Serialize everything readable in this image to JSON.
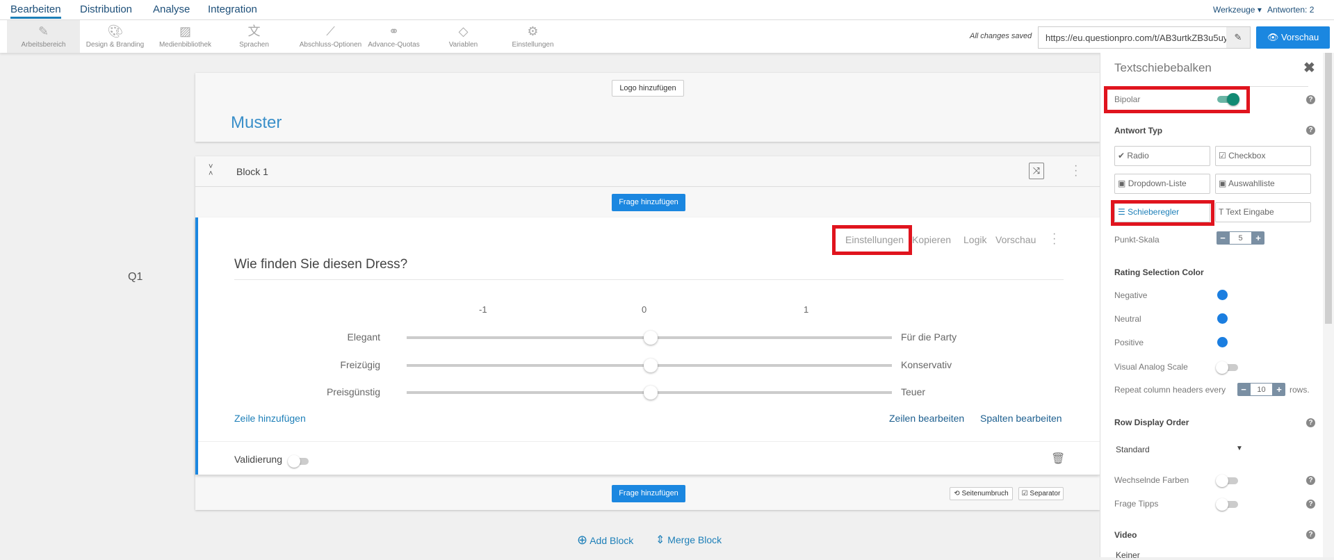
{
  "nav": {
    "tabs": [
      "Bearbeiten",
      "Distribution",
      "Analyse",
      "Integration"
    ],
    "tools": "Werkzeuge",
    "answers": "Antworten: 2"
  },
  "toolbar": {
    "items": [
      "Arbeitsbereich",
      "Design & Branding",
      "Medienbibliothek",
      "Sprachen",
      "Abschluss-Optionen",
      "Advance-Quotas",
      "Variablen",
      "Einstellungen"
    ],
    "saved": "All changes saved",
    "url": "https://eu.questionpro.com/t/AB3urtkZB3u5uy",
    "preview": "Vorschau"
  },
  "survey": {
    "logo_button": "Logo hinzufügen",
    "title": "Muster",
    "block": "Block 1",
    "add_question": "Frage hinzufügen",
    "qnum": "Q1",
    "question": {
      "actions": [
        "Einstellungen",
        "Kopieren",
        "Logik",
        "Vorschau"
      ],
      "text": "Wie finden Sie diesen Dress?",
      "scale": [
        "-1",
        "0",
        "1"
      ],
      "rows": [
        {
          "left": "Elegant",
          "right": "Für die Party",
          "value": 0
        },
        {
          "left": "Freizügig",
          "right": "Konservativ",
          "value": 0
        },
        {
          "left": "Preisgünstig",
          "right": "Teuer",
          "value": 0
        }
      ],
      "add_row": "Zeile hinzufügen",
      "edit_rows": "Zeilen bearbeiten",
      "edit_cols": "Spalten bearbeiten",
      "validation": "Validierung"
    },
    "page_break": "Seitenumbruch",
    "separator": "Separator",
    "add_block": "Add Block",
    "merge_block": "Merge Block"
  },
  "panel": {
    "title": "Textschiebebalken",
    "bipolar": "Bipolar",
    "answer_type": "Antwort Typ",
    "types": [
      "Radio",
      "Checkbox",
      "Dropdown-Liste",
      "Auswahlliste",
      "Schieberegler",
      "Text Eingabe"
    ],
    "point_scale": "Punkt-Skala",
    "point_scale_value": "5",
    "rating_color": "Rating Selection Color",
    "negative": "Negative",
    "neutral": "Neutral",
    "positive": "Positive",
    "rating_hex": "#1b7ee0",
    "vas": "Visual Analog Scale",
    "repeat": "Repeat column headers every",
    "repeat_value": "10",
    "rows": "rows.",
    "row_order": "Row Display Order",
    "standard": "Standard",
    "alt_colors": "Wechselnde Farben",
    "tips": "Frage Tipps",
    "video": "Video",
    "video_value": "Keiner"
  }
}
